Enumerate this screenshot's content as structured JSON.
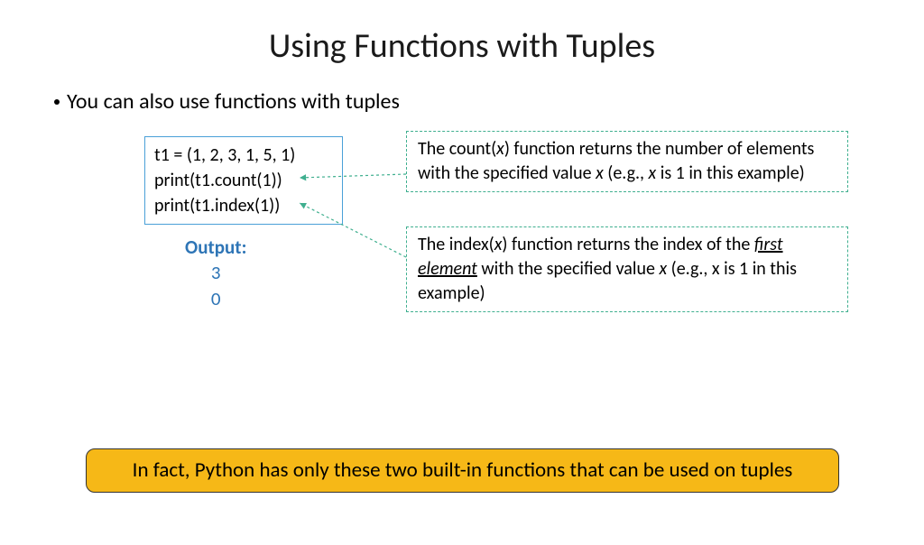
{
  "title": "Using Functions with Tuples",
  "bullet": "You can also use functions with tuples",
  "code": {
    "line1": "t1 = (1, 2, 3, 1, 5, 1)",
    "line2": "print(t1.count(1))",
    "line3": "print(t1.index(1))"
  },
  "output": {
    "label": "Output:",
    "val1": "3",
    "val2": "0"
  },
  "note_count": {
    "prefix": "The count(",
    "x1": "x",
    "mid1": ") function returns the number of elements with the specified value ",
    "x2": "x",
    "mid2": " (e.g., ",
    "x3": "x",
    "suffix": " is 1 in this example)"
  },
  "note_index": {
    "prefix": "The index(",
    "x1": "x",
    "mid1": ") function returns the index of the ",
    "first_elem": "first  element",
    "mid2": " with the specified value ",
    "x2": "x",
    "suffix": " (e.g., x is 1 in this example)"
  },
  "callout": "In fact, Python has only these two built-in functions that can be used on tuples"
}
